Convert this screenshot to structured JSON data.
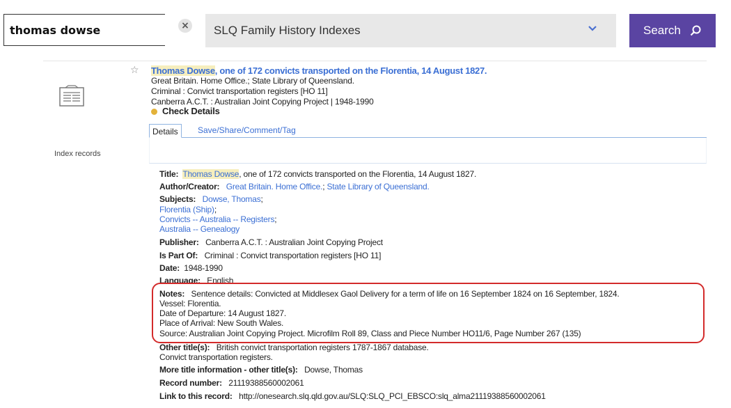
{
  "search": {
    "query": "thomas dowse",
    "clear_symbol": "×",
    "scope": "SLQ Family History Indexes",
    "button_label": "Search"
  },
  "result": {
    "type_label": "Index records",
    "star": "☆",
    "title_highlight": "Thomas Dowse",
    "title_rest": ", one of 172 convicts transported on the Florentia, 14 August 1827.",
    "line1": "Great Britain. Home Office.; State Library of Queensland.",
    "line2": "Criminal : Convict transportation registers [HO 11]",
    "line3": "Canberra A.C.T. : Australian Joint Copying Project | 1948-1990",
    "check_details": "Check Details"
  },
  "tabs": {
    "details": "Details",
    "share": "Save/Share/Comment/Tag"
  },
  "details": {
    "title_label": "Title:",
    "title_highlight": "Thomas Dowse",
    "title_rest": ", one of 172 convicts transported on the Florentia, 14 August 1827.",
    "author_label": "Author/Creator:",
    "author_1": "Great Britain. Home Office.",
    "author_sep": ";",
    "author_2": "State Library of Queensland.",
    "subjects_label": "Subjects:",
    "subject_1": "Dowse, Thomas",
    "subject_2": "Florentia (Ship)",
    "subject_3": "Convicts -- Australia -- Registers",
    "subject_4": "Australia -- Genealogy",
    "sep": ";",
    "publisher_label": "Publisher:",
    "publisher": "Canberra A.C.T. : Australian Joint Copying Project",
    "ispartof_label": "Is Part Of:",
    "ispartof": "Criminal : Convict transportation registers [HO 11]",
    "date_label": "Date:",
    "date": "1948-1990",
    "language_label": "Language:",
    "language": "English",
    "notes_label": "Notes:",
    "notes_1": "Sentence details: Convicted at Middlesex Gaol Delivery for a term of life on 16 September 1824 on 16 September, 1824.",
    "notes_2": "Vessel: Florentia.",
    "notes_3": "Date of Departure: 14 August 1827.",
    "notes_4": "Place of Arrival: New South Wales.",
    "notes_5": "Source: Australian Joint Copying Project. Microfilm Roll 89, Class and Piece Number HO11/6, Page Number 267 (135)",
    "other_label": "Other title(s):",
    "other_1": "British convict transportation registers 1787-1867 database.",
    "other_2": "Convict transportation registers.",
    "more_label": "More title information - other title(s):",
    "more": "Dowse, Thomas",
    "record_label": "Record number:",
    "record": "21119388560002061",
    "link_label": "Link to this record:",
    "link": "http://onesearch.slq.qld.gov.au/SLQ:SLQ_PCI_EBSCO:slq_alma21119388560002061"
  },
  "colors": {
    "accent": "#5a44a2",
    "link": "#3b6fd4",
    "highlight": "#f6eebd",
    "annotation": "#d32b2b"
  }
}
